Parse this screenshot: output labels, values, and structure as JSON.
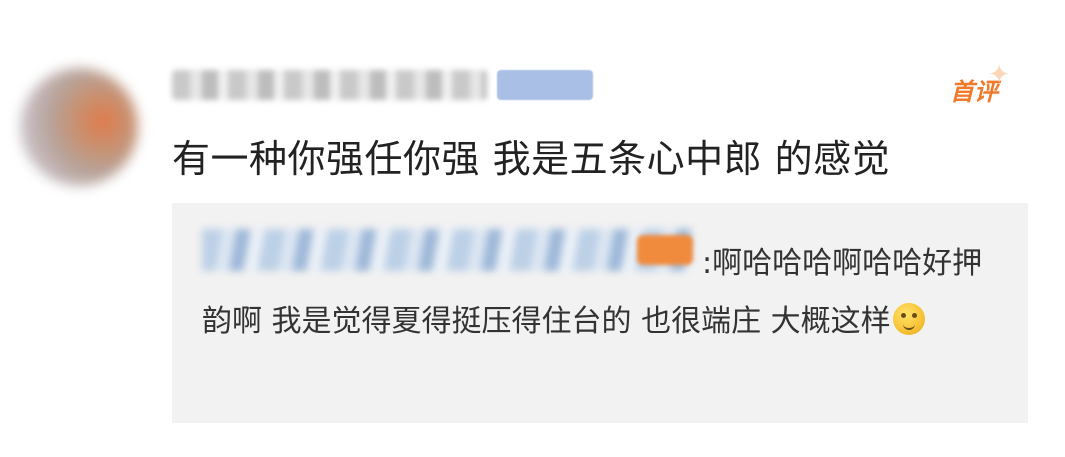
{
  "header": {
    "first_comment_label": "首评"
  },
  "comment": {
    "text": "有一种你强任你强 我是五条心中郎 的感觉"
  },
  "reply": {
    "text": ":啊哈哈哈啊哈哈好押韵啊 我是觉得夏得挺压得住台的 也很端庄 大概这样"
  },
  "icons": {
    "avatar": "avatar",
    "emoji": "thinking-face-icon"
  },
  "colors": {
    "accent": "#f07a2c",
    "reply_background": "#f2f2f2"
  }
}
